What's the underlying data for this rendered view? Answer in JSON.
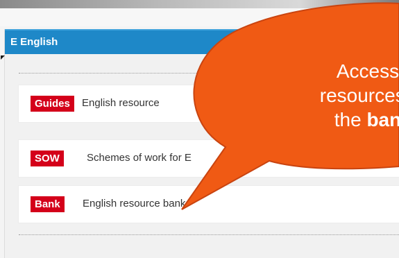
{
  "panel": {
    "title": "E English",
    "header_color": "#1e88c8"
  },
  "rows": [
    {
      "badge": "Guides",
      "text": "English resource"
    },
    {
      "badge": "SOW",
      "text": "Schemes of work for E"
    },
    {
      "badge": "Bank",
      "text": "English resource bank"
    }
  ],
  "callout": {
    "line1": "Access",
    "line2": "resources f",
    "line3_prefix": "the ",
    "line3_bold": "ban",
    "fill_color": "#f05a14",
    "stroke_color": "#c94410"
  },
  "colors": {
    "badge_red": "#d4001a"
  }
}
